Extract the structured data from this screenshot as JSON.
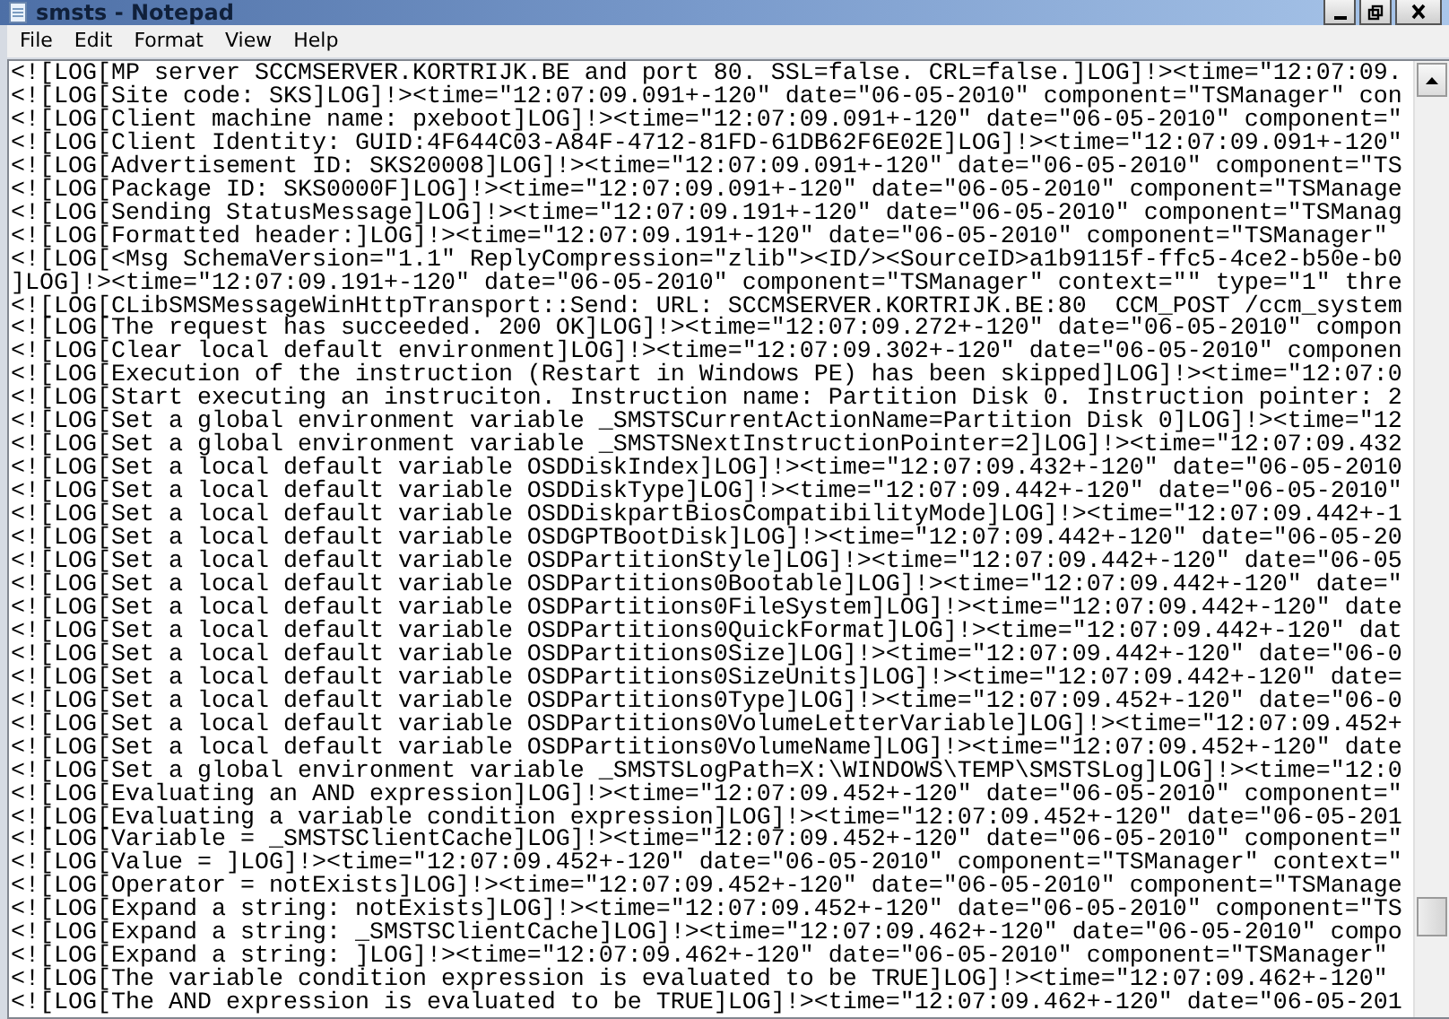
{
  "window": {
    "title": "smsts - Notepad"
  },
  "menu": [
    "File",
    "Edit",
    "Format",
    "View",
    "Help"
  ],
  "lines": [
    "<![LOG[MP server SCCMSERVER.KORTRIJK.BE and port 80. SSL=false. CRL=false.]LOG]!><time=\"12:07:09.",
    "<![LOG[Site code: SKS]LOG]!><time=\"12:07:09.091+-120\" date=\"06-05-2010\" component=\"TSManager\" con",
    "<![LOG[Client machine name: pxeboot]LOG]!><time=\"12:07:09.091+-120\" date=\"06-05-2010\" component=\"",
    "<![LOG[Client Identity: GUID:4F644C03-A84F-4712-81FD-61DB62F6E02E]LOG]!><time=\"12:07:09.091+-120\"",
    "<![LOG[Advertisement ID: SKS20008]LOG]!><time=\"12:07:09.091+-120\" date=\"06-05-2010\" component=\"TS",
    "<![LOG[Package ID: SKS0000F]LOG]!><time=\"12:07:09.091+-120\" date=\"06-05-2010\" component=\"TSManage",
    "<![LOG[Sending StatusMessage]LOG]!><time=\"12:07:09.191+-120\" date=\"06-05-2010\" component=\"TSManag",
    "<![LOG[Formatted header:]LOG]!><time=\"12:07:09.191+-120\" date=\"06-05-2010\" component=\"TSManager\"",
    "<![LOG[<Msg SchemaVersion=\"1.1\" ReplyCompression=\"zlib\"><ID/><SourceID>a1b9115f-ffc5-4ce2-b50e-b0",
    "]LOG]!><time=\"12:07:09.191+-120\" date=\"06-05-2010\" component=\"TSManager\" context=\"\" type=\"1\" thre",
    "<![LOG[CLibSMSMessageWinHttpTransport::Send: URL: SCCMSERVER.KORTRIJK.BE:80  CCM_POST /ccm_system",
    "<![LOG[The request has succeeded. 200 OK]LOG]!><time=\"12:07:09.272+-120\" date=\"06-05-2010\" compon",
    "<![LOG[Clear local default environment]LOG]!><time=\"12:07:09.302+-120\" date=\"06-05-2010\" componen",
    "<![LOG[Execution of the instruction (Restart in Windows PE) has been skipped]LOG]!><time=\"12:07:0",
    "<![LOG[Start executing an instruciton. Instruction name: Partition Disk 0. Instruction pointer: 2",
    "<![LOG[Set a global environment variable _SMSTSCurrentActionName=Partition Disk 0]LOG]!><time=\"12",
    "<![LOG[Set a global environment variable _SMSTSNextInstructionPointer=2]LOG]!><time=\"12:07:09.432",
    "<![LOG[Set a local default variable OSDDiskIndex]LOG]!><time=\"12:07:09.432+-120\" date=\"06-05-2010",
    "<![LOG[Set a local default variable OSDDiskType]LOG]!><time=\"12:07:09.442+-120\" date=\"06-05-2010\"",
    "<![LOG[Set a local default variable OSDDiskpartBiosCompatibilityMode]LOG]!><time=\"12:07:09.442+-1",
    "<![LOG[Set a local default variable OSDGPTBootDisk]LOG]!><time=\"12:07:09.442+-120\" date=\"06-05-20",
    "<![LOG[Set a local default variable OSDPartitionStyle]LOG]!><time=\"12:07:09.442+-120\" date=\"06-05",
    "<![LOG[Set a local default variable OSDPartitions0Bootable]LOG]!><time=\"12:07:09.442+-120\" date=\"",
    "<![LOG[Set a local default variable OSDPartitions0FileSystem]LOG]!><time=\"12:07:09.442+-120\" date",
    "<![LOG[Set a local default variable OSDPartitions0QuickFormat]LOG]!><time=\"12:07:09.442+-120\" dat",
    "<![LOG[Set a local default variable OSDPartitions0Size]LOG]!><time=\"12:07:09.442+-120\" date=\"06-0",
    "<![LOG[Set a local default variable OSDPartitions0SizeUnits]LOG]!><time=\"12:07:09.442+-120\" date=",
    "<![LOG[Set a local default variable OSDPartitions0Type]LOG]!><time=\"12:07:09.452+-120\" date=\"06-0",
    "<![LOG[Set a local default variable OSDPartitions0VolumeLetterVariable]LOG]!><time=\"12:07:09.452+",
    "<![LOG[Set a local default variable OSDPartitions0VolumeName]LOG]!><time=\"12:07:09.452+-120\" date",
    "<![LOG[Set a global environment variable _SMSTSLogPath=X:\\WINDOWS\\TEMP\\SMSTSLog]LOG]!><time=\"12:0",
    "<![LOG[Evaluating an AND expression]LOG]!><time=\"12:07:09.452+-120\" date=\"06-05-2010\" component=\"",
    "<![LOG[Evaluating a variable condition expression]LOG]!><time=\"12:07:09.452+-120\" date=\"06-05-201",
    "<![LOG[Variable = _SMSTSClientCache]LOG]!><time=\"12:07:09.452+-120\" date=\"06-05-2010\" component=\"",
    "<![LOG[Value = ]LOG]!><time=\"12:07:09.452+-120\" date=\"06-05-2010\" component=\"TSManager\" context=\"",
    "<![LOG[Operator = notExists]LOG]!><time=\"12:07:09.452+-120\" date=\"06-05-2010\" component=\"TSManage",
    "<![LOG[Expand a string: notExists]LOG]!><time=\"12:07:09.452+-120\" date=\"06-05-2010\" component=\"TS",
    "<![LOG[Expand a string: _SMSTSClientCache]LOG]!><time=\"12:07:09.462+-120\" date=\"06-05-2010\" compo",
    "<![LOG[Expand a string: ]LOG]!><time=\"12:07:09.462+-120\" date=\"06-05-2010\" component=\"TSManager\"",
    "<![LOG[The variable condition expression is evaluated to be TRUE]LOG]!><time=\"12:07:09.462+-120\"",
    "<![LOG[The AND expression is evaluated to be TRUE]LOG]!><time=\"12:07:09.462+-120\" date=\"06-05-201"
  ]
}
